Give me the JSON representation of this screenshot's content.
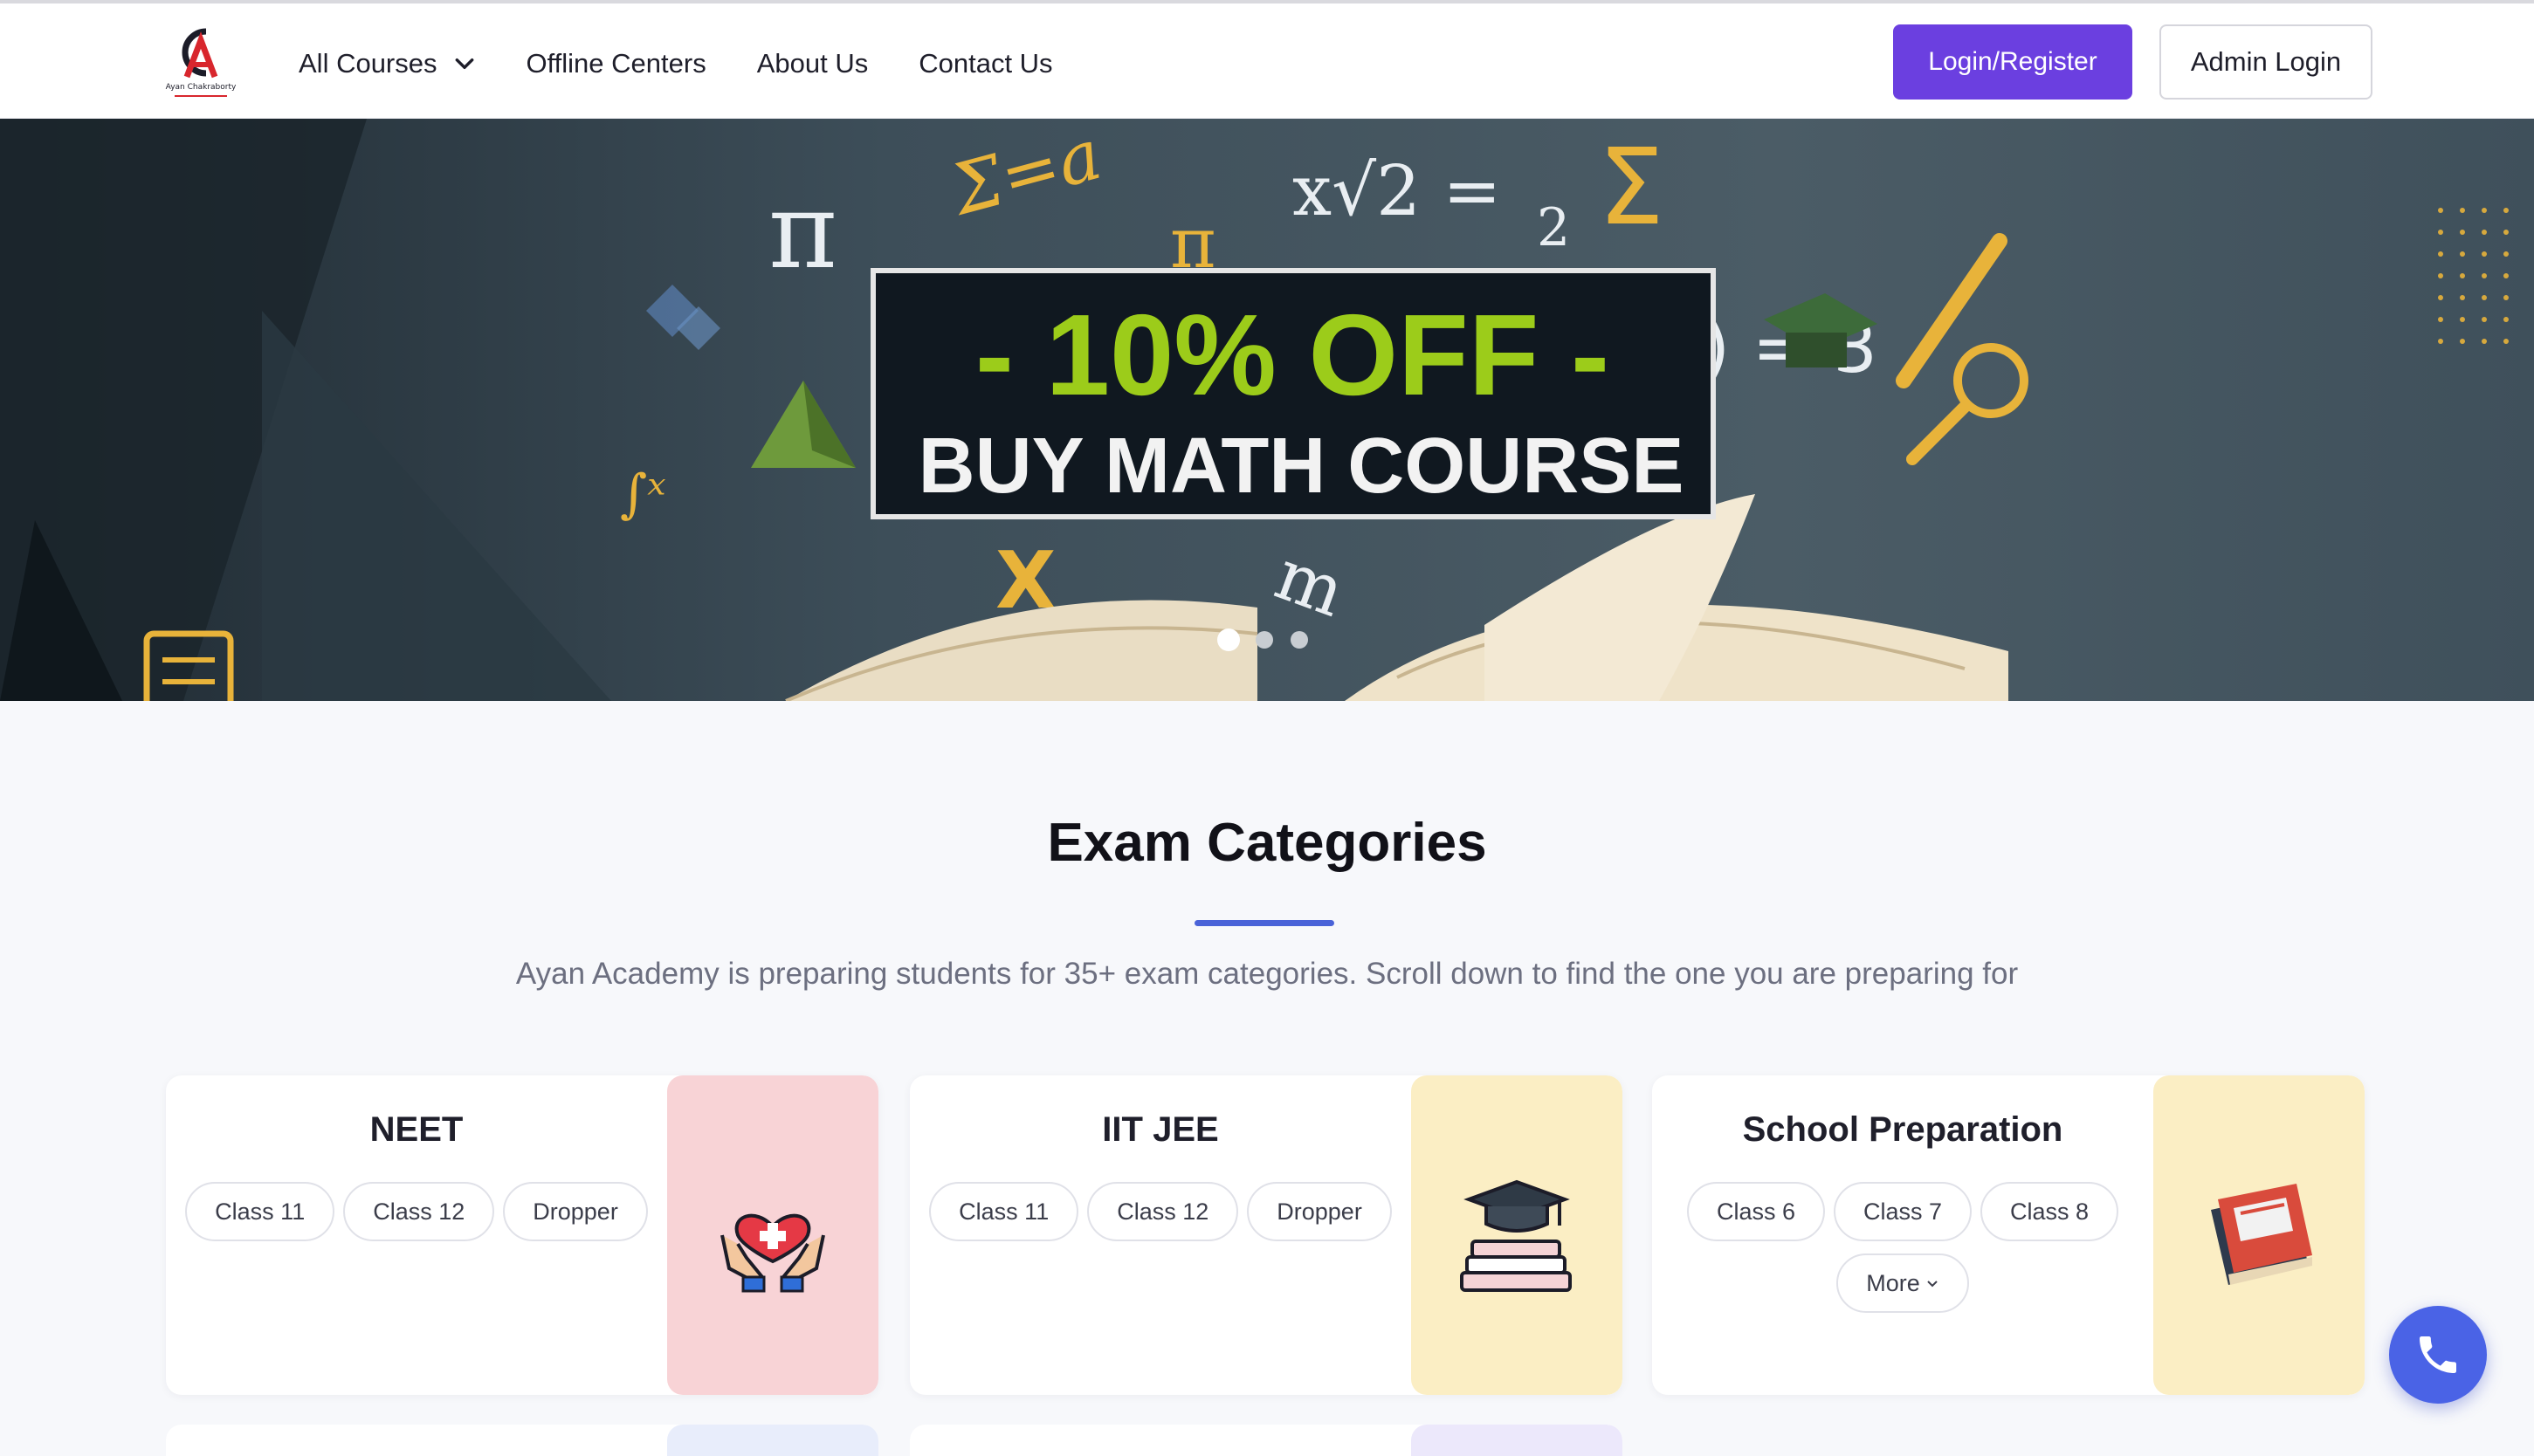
{
  "header": {
    "logo_text": "Ayan Chakraborty",
    "nav": [
      {
        "label": "All Courses",
        "has_dropdown": true
      },
      {
        "label": "Offline Centers"
      },
      {
        "label": "About Us"
      },
      {
        "label": "Contact Us"
      }
    ],
    "login_label": "Login/Register",
    "admin_label": "Admin Login",
    "colors": {
      "primary": "#6b3fe0",
      "accent": "#4a63d8"
    }
  },
  "banner": {
    "line1": "- 10% OFF -",
    "line2": "BUY MATH COURSE",
    "math_symbols": [
      "π",
      "Σ=a",
      "x√2 = 2",
      "Σ",
      ") = 3",
      "π",
      "X",
      "m"
    ],
    "slides": 3,
    "active_slide": 1
  },
  "section": {
    "title": "Exam Categories",
    "subtitle": "Ayan Academy is preparing students for 35+ exam categories. Scroll down to find the one you are preparing for"
  },
  "categories": [
    {
      "title": "NEET",
      "chips": [
        "Class 11",
        "Class 12",
        "Dropper"
      ],
      "icon": "heart-hands-icon",
      "bg": "#f8d3d6"
    },
    {
      "title": "IIT JEE",
      "chips": [
        "Class 11",
        "Class 12",
        "Dropper"
      ],
      "icon": "graduation-books-icon",
      "bg": "#fbeec4"
    },
    {
      "title": "School Preparation",
      "chips": [
        "Class 6",
        "Class 7",
        "Class 8",
        "More"
      ],
      "icon": "book-icon",
      "bg": "#fbeec4"
    }
  ],
  "fab": {
    "icon": "phone-icon"
  }
}
